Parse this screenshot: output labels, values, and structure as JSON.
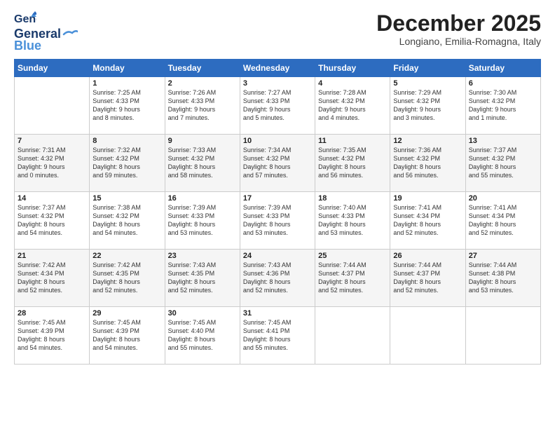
{
  "logo": {
    "line1": "General",
    "line2": "Blue"
  },
  "header": {
    "month": "December 2025",
    "location": "Longiano, Emilia-Romagna, Italy"
  },
  "weekdays": [
    "Sunday",
    "Monday",
    "Tuesday",
    "Wednesday",
    "Thursday",
    "Friday",
    "Saturday"
  ],
  "weeks": [
    [
      {
        "day": "",
        "info": ""
      },
      {
        "day": "1",
        "info": "Sunrise: 7:25 AM\nSunset: 4:33 PM\nDaylight: 9 hours\nand 8 minutes."
      },
      {
        "day": "2",
        "info": "Sunrise: 7:26 AM\nSunset: 4:33 PM\nDaylight: 9 hours\nand 7 minutes."
      },
      {
        "day": "3",
        "info": "Sunrise: 7:27 AM\nSunset: 4:33 PM\nDaylight: 9 hours\nand 5 minutes."
      },
      {
        "day": "4",
        "info": "Sunrise: 7:28 AM\nSunset: 4:32 PM\nDaylight: 9 hours\nand 4 minutes."
      },
      {
        "day": "5",
        "info": "Sunrise: 7:29 AM\nSunset: 4:32 PM\nDaylight: 9 hours\nand 3 minutes."
      },
      {
        "day": "6",
        "info": "Sunrise: 7:30 AM\nSunset: 4:32 PM\nDaylight: 9 hours\nand 1 minute."
      }
    ],
    [
      {
        "day": "7",
        "info": "Sunrise: 7:31 AM\nSunset: 4:32 PM\nDaylight: 9 hours\nand 0 minutes."
      },
      {
        "day": "8",
        "info": "Sunrise: 7:32 AM\nSunset: 4:32 PM\nDaylight: 8 hours\nand 59 minutes."
      },
      {
        "day": "9",
        "info": "Sunrise: 7:33 AM\nSunset: 4:32 PM\nDaylight: 8 hours\nand 58 minutes."
      },
      {
        "day": "10",
        "info": "Sunrise: 7:34 AM\nSunset: 4:32 PM\nDaylight: 8 hours\nand 57 minutes."
      },
      {
        "day": "11",
        "info": "Sunrise: 7:35 AM\nSunset: 4:32 PM\nDaylight: 8 hours\nand 56 minutes."
      },
      {
        "day": "12",
        "info": "Sunrise: 7:36 AM\nSunset: 4:32 PM\nDaylight: 8 hours\nand 56 minutes."
      },
      {
        "day": "13",
        "info": "Sunrise: 7:37 AM\nSunset: 4:32 PM\nDaylight: 8 hours\nand 55 minutes."
      }
    ],
    [
      {
        "day": "14",
        "info": "Sunrise: 7:37 AM\nSunset: 4:32 PM\nDaylight: 8 hours\nand 54 minutes."
      },
      {
        "day": "15",
        "info": "Sunrise: 7:38 AM\nSunset: 4:32 PM\nDaylight: 8 hours\nand 54 minutes."
      },
      {
        "day": "16",
        "info": "Sunrise: 7:39 AM\nSunset: 4:33 PM\nDaylight: 8 hours\nand 53 minutes."
      },
      {
        "day": "17",
        "info": "Sunrise: 7:39 AM\nSunset: 4:33 PM\nDaylight: 8 hours\nand 53 minutes."
      },
      {
        "day": "18",
        "info": "Sunrise: 7:40 AM\nSunset: 4:33 PM\nDaylight: 8 hours\nand 53 minutes."
      },
      {
        "day": "19",
        "info": "Sunrise: 7:41 AM\nSunset: 4:34 PM\nDaylight: 8 hours\nand 52 minutes."
      },
      {
        "day": "20",
        "info": "Sunrise: 7:41 AM\nSunset: 4:34 PM\nDaylight: 8 hours\nand 52 minutes."
      }
    ],
    [
      {
        "day": "21",
        "info": "Sunrise: 7:42 AM\nSunset: 4:34 PM\nDaylight: 8 hours\nand 52 minutes."
      },
      {
        "day": "22",
        "info": "Sunrise: 7:42 AM\nSunset: 4:35 PM\nDaylight: 8 hours\nand 52 minutes."
      },
      {
        "day": "23",
        "info": "Sunrise: 7:43 AM\nSunset: 4:35 PM\nDaylight: 8 hours\nand 52 minutes."
      },
      {
        "day": "24",
        "info": "Sunrise: 7:43 AM\nSunset: 4:36 PM\nDaylight: 8 hours\nand 52 minutes."
      },
      {
        "day": "25",
        "info": "Sunrise: 7:44 AM\nSunset: 4:37 PM\nDaylight: 8 hours\nand 52 minutes."
      },
      {
        "day": "26",
        "info": "Sunrise: 7:44 AM\nSunset: 4:37 PM\nDaylight: 8 hours\nand 52 minutes."
      },
      {
        "day": "27",
        "info": "Sunrise: 7:44 AM\nSunset: 4:38 PM\nDaylight: 8 hours\nand 53 minutes."
      }
    ],
    [
      {
        "day": "28",
        "info": "Sunrise: 7:45 AM\nSunset: 4:39 PM\nDaylight: 8 hours\nand 54 minutes."
      },
      {
        "day": "29",
        "info": "Sunrise: 7:45 AM\nSunset: 4:39 PM\nDaylight: 8 hours\nand 54 minutes."
      },
      {
        "day": "30",
        "info": "Sunrise: 7:45 AM\nSunset: 4:40 PM\nDaylight: 8 hours\nand 55 minutes."
      },
      {
        "day": "31",
        "info": "Sunrise: 7:45 AM\nSunset: 4:41 PM\nDaylight: 8 hours\nand 55 minutes."
      },
      {
        "day": "",
        "info": ""
      },
      {
        "day": "",
        "info": ""
      },
      {
        "day": "",
        "info": ""
      }
    ]
  ]
}
